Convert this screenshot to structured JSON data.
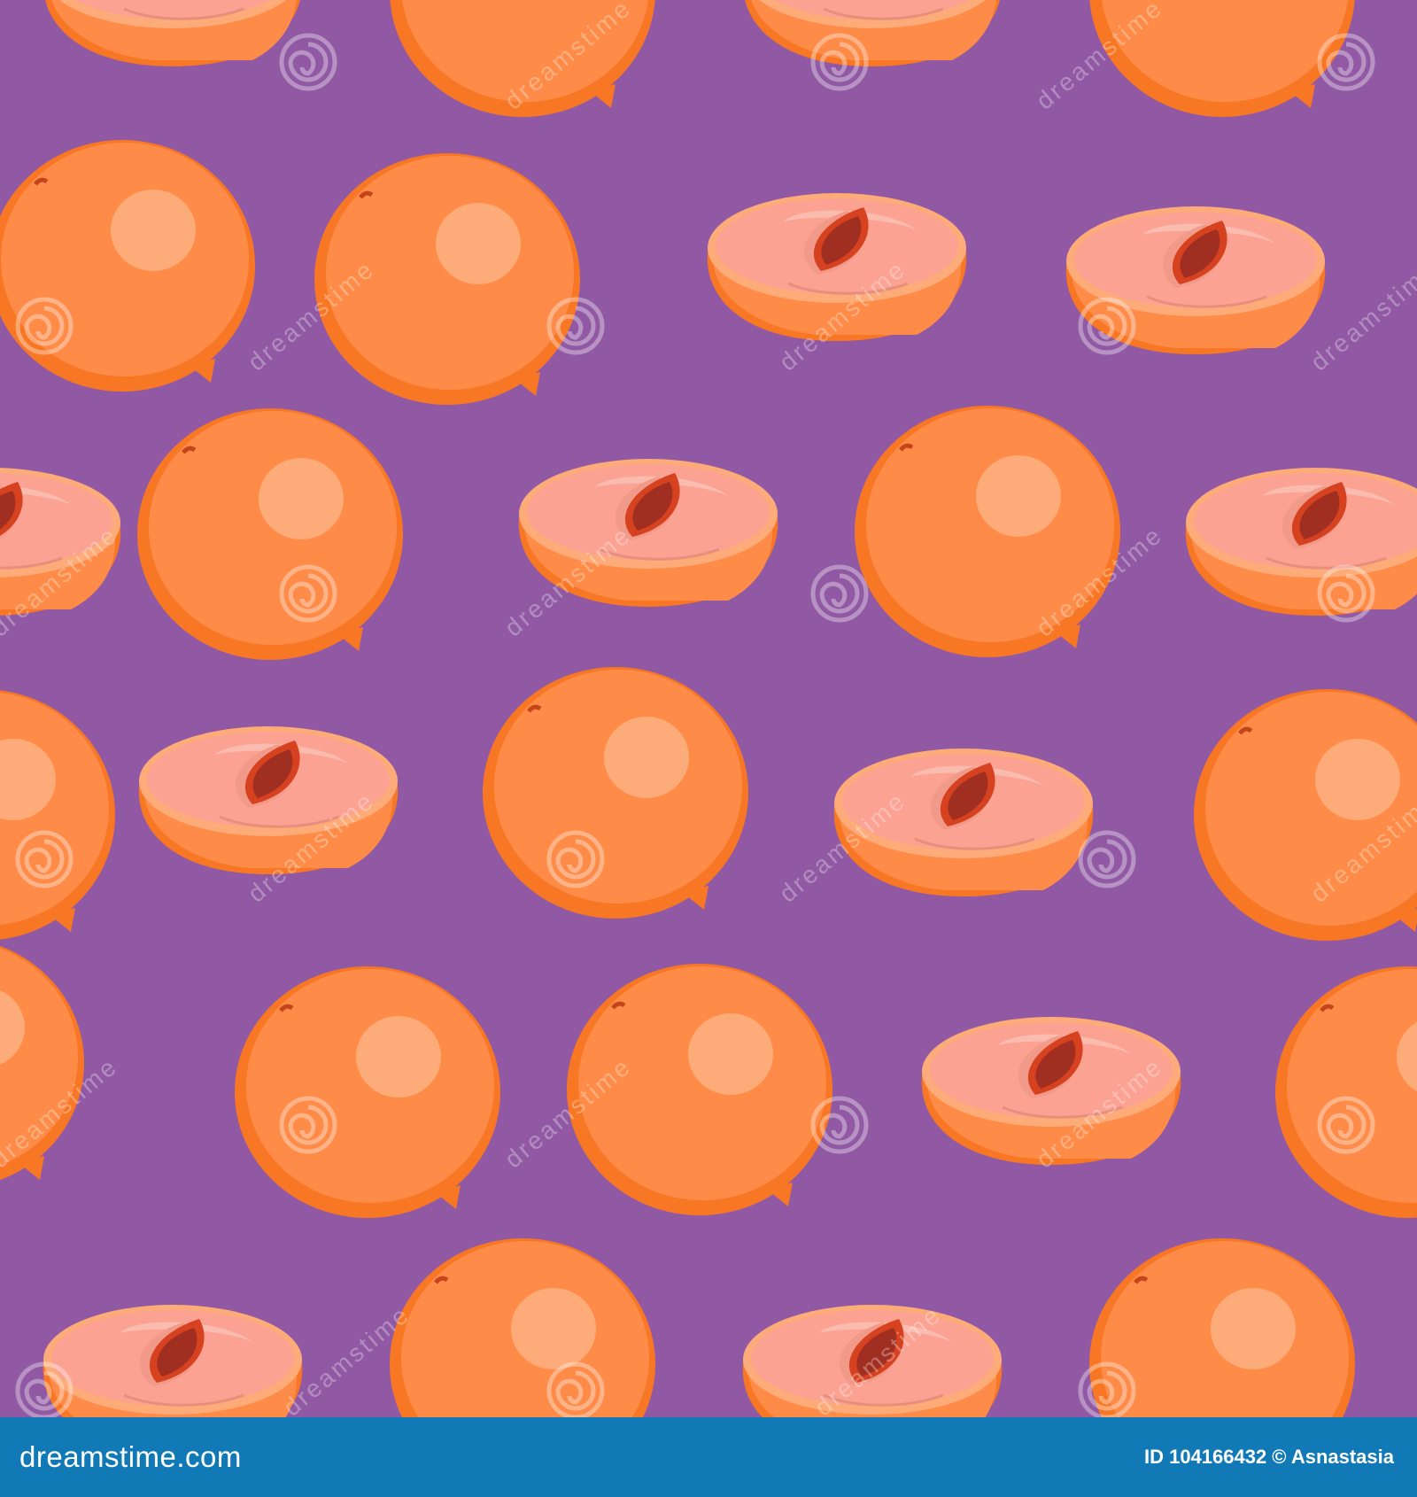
{
  "colors": {
    "background": "#9159a4",
    "footer_bar": "#1079b6",
    "skin_main": "#fe8c48",
    "skin_shadow": "#f77725",
    "skin_highlight": "#fdab78",
    "flesh": "#fca293",
    "flesh_inner": "#fbbcb0",
    "flesh_shade": "#f29a8a",
    "seed_outer": "#d6421f",
    "seed_inner": "#a02f21",
    "watermark": "#ffffff"
  },
  "subject": {
    "whole_fruit_icon": "whole-orange-fruit-icon",
    "half_fruit_icon": "halved-fruit-with-seed-icon",
    "watermark_icon": "spiral-logo-watermark-icon"
  },
  "watermark": {
    "text": "dreamstime"
  },
  "footer": {
    "site": "dreamstime.com",
    "credit": "ID 104166432 © Asnastasia"
  }
}
